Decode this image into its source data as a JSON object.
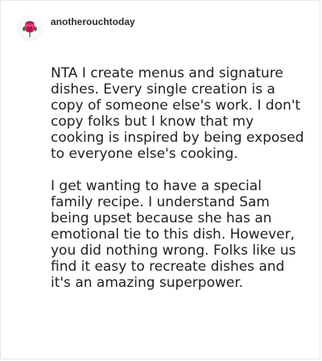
{
  "post": {
    "username": "anotherouchtoday",
    "avatar_icon": "rose-flower-icon",
    "paragraphs": [
      "NTA I create menus and signature dishes. Every single creation is a copy of someone else's work. I don't copy folks but I know that my cooking is inspired by being exposed to everyone else's cooking.",
      "I get wanting to have a special family recipe. I understand Sam being upset because she has an emotional tie to this dish. However, you did nothing wrong. Folks like us find it easy to recreate dishes and it's an amazing superpower."
    ]
  },
  "colors": {
    "background": "#ffffff",
    "border": "#e6e6e6",
    "text": "#1f1f1f",
    "avatar_flower": "#d81b60"
  }
}
